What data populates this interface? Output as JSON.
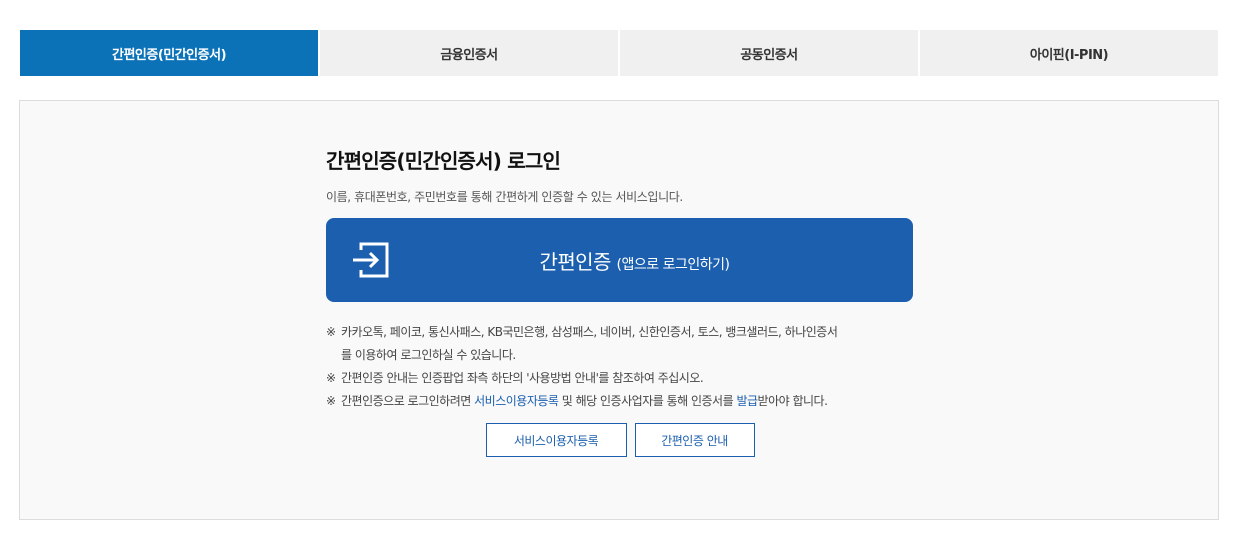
{
  "tabs": [
    {
      "label": "간편인증(민간인증서)",
      "active": true
    },
    {
      "label": "금융인증서",
      "active": false
    },
    {
      "label": "공동인증서",
      "active": false
    },
    {
      "label": "아이핀(I-PIN)",
      "active": false
    }
  ],
  "panel": {
    "title": "간편인증(민간인증서) 로그인",
    "description": "이름, 휴대폰번호, 주민번호를 통해 간편하게 인증할 수 있는 서비스입니다.",
    "main_button": {
      "icon": "login-icon",
      "label": "간편인증",
      "sub_label": "(앱으로 로그인하기)"
    },
    "notes": {
      "mark": "※",
      "note1_line1": "카카오톡, 페이코, 통신사패스, KB국민은행, 삼성패스, 네이버, 신한인증서, 토스, 뱅크샐러드, 하나인증서",
      "note1_line2": "를 이용하여 로그인하실 수 있습니다.",
      "note2": "간편인증 안내는 인증팝업 좌측 하단의 '사용방법 안내'를 참조하여 주십시오.",
      "note3_part1": "간편인증으로 로그인하려면 ",
      "note3_link1": "서비스이용자등록",
      "note3_part2": " 및 해당 인증사업자를 통해 인증서를 ",
      "note3_link2": "발급",
      "note3_part3": "받아야 합니다."
    },
    "buttons": {
      "register": "서비스이용자등록",
      "guide": "간편인증 안내"
    }
  },
  "colors": {
    "accent": "#1b5fae",
    "active_tab": "#0b72b8",
    "tab_bg": "#f0f0f0",
    "panel_bg": "#f9f9f9"
  }
}
